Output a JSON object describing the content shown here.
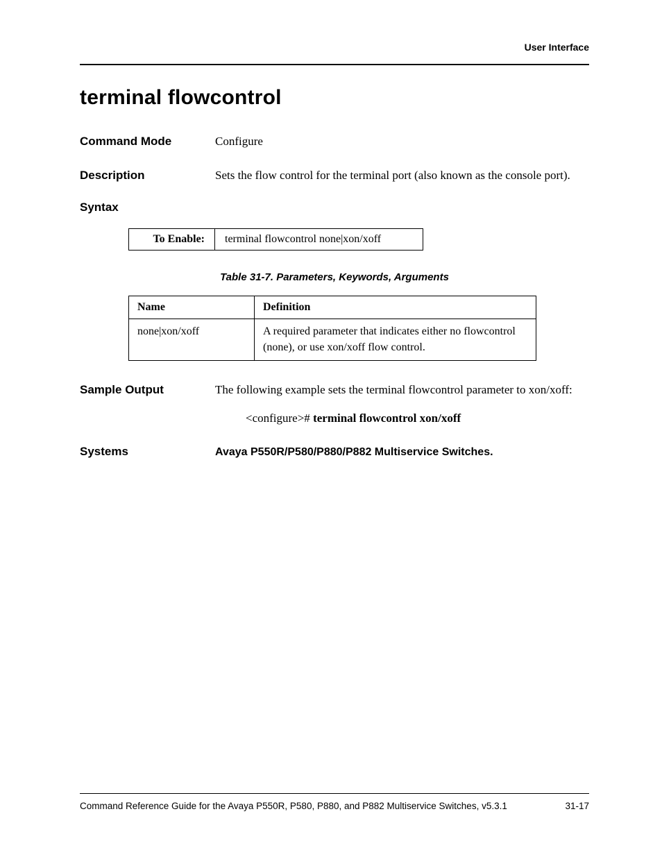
{
  "header": {
    "running_head": "User Interface"
  },
  "title": "terminal flowcontrol",
  "sections": {
    "command_mode": {
      "label": "Command Mode",
      "value": "Configure"
    },
    "description": {
      "label": "Description",
      "value": "Sets the flow control for the terminal port (also known as the console port)."
    },
    "syntax": {
      "label": "Syntax",
      "enable_label": "To Enable:",
      "enable_cmd": "terminal flowcontrol none|xon/xoff"
    },
    "params_table": {
      "caption": "Table 31-7.  Parameters, Keywords, Arguments",
      "headers": {
        "name": "Name",
        "definition": "Definition"
      },
      "rows": [
        {
          "name": "none|xon/xoff",
          "definition": "A required parameter that indicates either no flowcontrol (none), or use xon/xoff flow control."
        }
      ]
    },
    "sample_output": {
      "label": "Sample Output",
      "intro": "The following example sets the terminal flowcontrol parameter to xon/xoff:",
      "prompt": "<configure># ",
      "cmd_bold": "terminal flowcontrol xon/xoff"
    },
    "systems": {
      "label": "Systems",
      "value": "Avaya P550R/P580/P880/P882 Multiservice Switches."
    }
  },
  "footer": {
    "left": "Command Reference Guide for the Avaya P550R, P580, P880, and P882 Multiservice Switches, v5.3.1",
    "right": "31-17"
  }
}
